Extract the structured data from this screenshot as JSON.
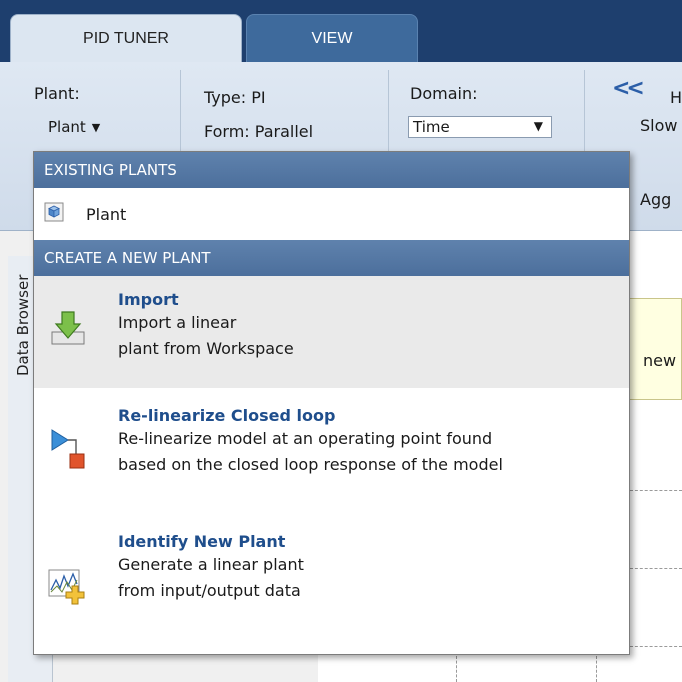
{
  "tabs": [
    {
      "label": "PID TUNER",
      "active": true
    },
    {
      "label": "VIEW",
      "active": false
    }
  ],
  "toolstrip": {
    "plant_label": "Plant:",
    "plant_button": "Plant",
    "type_text": "Type:  PI",
    "form_text": "Form: Parallel",
    "domain_label": "Domain:",
    "domain_value": "Time",
    "partial_h": "H",
    "partial_slow": "Slow",
    "partial_agg": "Agg"
  },
  "left_panel": {
    "vertical_tab_label": "Data Browser"
  },
  "plot": {
    "banner_text": "new"
  },
  "dropdown": {
    "existing_header": "EXISTING PLANTS",
    "existing_items": [
      {
        "label": "Plant",
        "icon": "plant-cube-icon"
      }
    ],
    "create_header": "CREATE A NEW PLANT",
    "actions": [
      {
        "title": "Import",
        "line1": "Import a linear",
        "line2": "plant from Workspace",
        "icon": "import-arrow-icon"
      },
      {
        "title": "Re-linearize Closed loop",
        "line1": "Re-linearize model at an operating point found",
        "line2": "based on the closed loop response of the model",
        "icon": "relinearize-icon"
      },
      {
        "title": "Identify New Plant",
        "line1": "Generate a linear plant",
        "line2": "from input/output data",
        "icon": "identify-plant-icon"
      }
    ]
  },
  "colors": {
    "tabstrip_bg": "#1e3f6e",
    "section_header_bg": "#4c6f9c",
    "action_title": "#1f4e8c",
    "hover_bg": "#eaeaea"
  }
}
